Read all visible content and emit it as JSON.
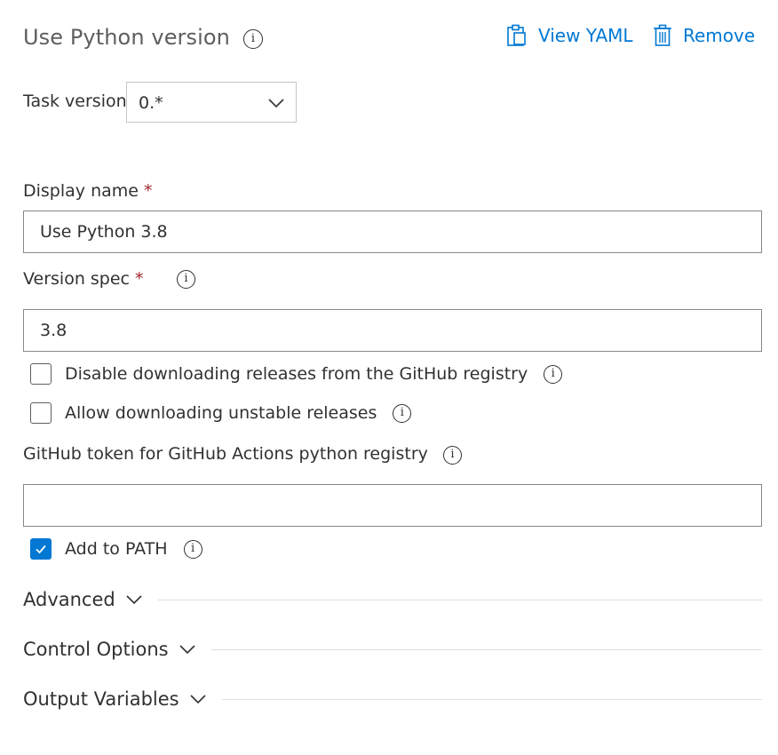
{
  "header": {
    "title": "Use Python version",
    "view_yaml_label": "View YAML",
    "remove_label": "Remove"
  },
  "task_version": {
    "label": "Task version",
    "value": "0.*"
  },
  "display_name": {
    "label": "Display name",
    "required_mark": "*",
    "value": "Use Python 3.8"
  },
  "version_spec": {
    "label": "Version spec",
    "required_mark": "*",
    "value": "3.8"
  },
  "options": {
    "disable_github": {
      "label": "Disable downloading releases from the GitHub registry",
      "checked": false
    },
    "allow_unstable": {
      "label": "Allow downloading unstable releases",
      "checked": false
    }
  },
  "github_token": {
    "label": "GitHub token for GitHub Actions python registry",
    "value": ""
  },
  "add_to_path": {
    "label": "Add to PATH",
    "checked": true
  },
  "sections": {
    "advanced": "Advanced",
    "control_options": "Control Options",
    "output_variables": "Output Variables"
  },
  "colors": {
    "accent": "#0078d4",
    "required": "#a4262c",
    "text": "#323130",
    "title": "#605e5c"
  },
  "icons": {
    "info": "info-icon",
    "view_yaml": "clipboard-icon",
    "remove": "trash-icon",
    "dropdown": "chevron-down-icon",
    "checkbox_check": "checkmark-icon"
  }
}
